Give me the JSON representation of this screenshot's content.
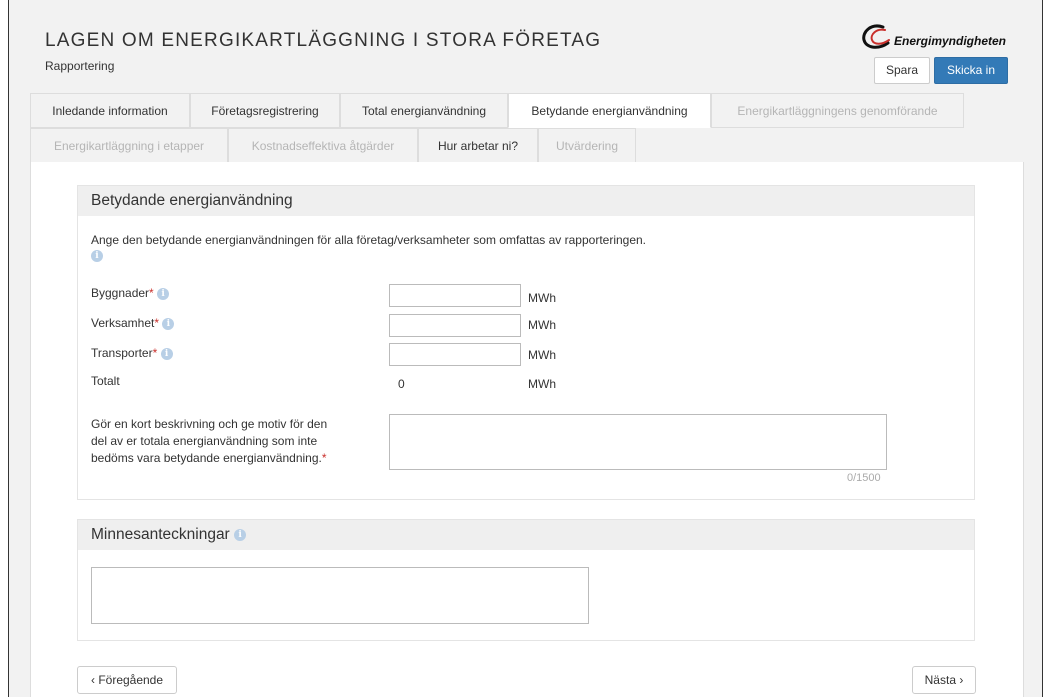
{
  "header": {
    "title": "LAGEN OM ENERGIKARTLÄGGNING I STORA FÖRETAG",
    "subtitle": "Rapportering",
    "logo_text": "Energimyndigheten",
    "save_label": "Spara",
    "submit_label": "Skicka in"
  },
  "tabs": [
    {
      "label": "Inledande information",
      "state": "enabled"
    },
    {
      "label": "Företagsregistrering",
      "state": "enabled"
    },
    {
      "label": "Total energianvändning",
      "state": "enabled"
    },
    {
      "label": "Betydande energianvändning",
      "state": "active"
    },
    {
      "label": "Energikartläggningens genomförande",
      "state": "disabled"
    },
    {
      "label": "Energikartläggning i etapper",
      "state": "disabled"
    },
    {
      "label": "Kostnadseffektiva åtgärder",
      "state": "disabled"
    },
    {
      "label": "Hur arbetar ni?",
      "state": "enabled"
    },
    {
      "label": "Utvärdering",
      "state": "disabled"
    }
  ],
  "section": {
    "title": "Betydande energianvändning",
    "intro": "Ange den betydande energianvändningen för alla företag/verksamheter som omfattas av rapporteringen.",
    "fields": [
      {
        "label": "Byggnader",
        "required_mark": "*",
        "value": "",
        "unit": "MWh"
      },
      {
        "label": "Verksamhet",
        "required_mark": "*",
        "value": "",
        "unit": "MWh"
      },
      {
        "label": "Transporter",
        "required_mark": "*",
        "value": "",
        "unit": "MWh"
      }
    ],
    "total": {
      "label": "Totalt",
      "value": "0",
      "unit": "MWh"
    },
    "description": {
      "label_lines": [
        "Gör en kort beskrivning och ge motiv för den",
        "del av er totala energianvändning som inte",
        "bedöms vara betydande energianvändning."
      ],
      "required_mark": "*",
      "value": "",
      "counter": "0/1500"
    }
  },
  "notes": {
    "title": "Minnesanteckningar",
    "value": ""
  },
  "nav": {
    "prev_label": "Föregående",
    "next_label": "Nästa"
  },
  "colors": {
    "accent": "#337ab7",
    "required": "#c9302c",
    "info_icon": "#b8cfe6"
  }
}
